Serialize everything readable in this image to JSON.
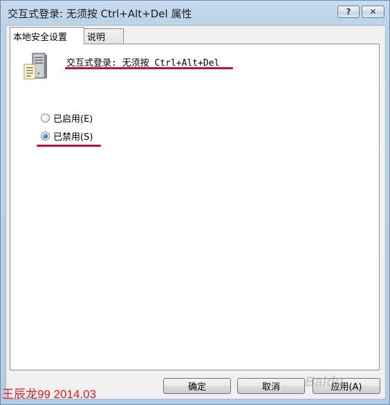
{
  "window": {
    "title": "交互式登录: 无须按 Ctrl+Alt+Del 属性",
    "help_label": "?",
    "close_label": "✕"
  },
  "tabs": [
    {
      "label": "本地安全设置",
      "active": true
    },
    {
      "label": "说明",
      "active": false
    }
  ],
  "policy": {
    "icon": "server-document-icon",
    "name": "交互式登录: 无须按 Ctrl+Alt+Del"
  },
  "options": [
    {
      "label": "已启用(E)",
      "checked": false
    },
    {
      "label": "已禁用(S)",
      "checked": true
    }
  ],
  "buttons": {
    "ok": "确定",
    "cancel": "取消",
    "apply": "应用(A)"
  },
  "watermark": {
    "author": "王辰龙99 2014.03",
    "site": "Baidu"
  },
  "colors": {
    "annotation_red": "#c8102e",
    "watermark_red": "#d81e1e"
  }
}
